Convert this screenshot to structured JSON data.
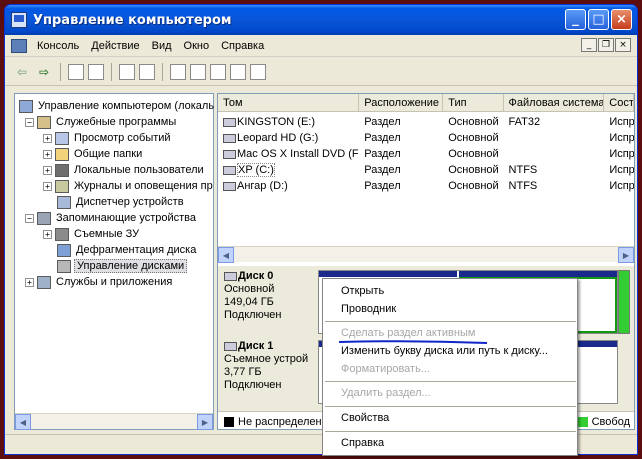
{
  "window": {
    "title": "Управление компьютером",
    "buttons": {
      "minimize": "_",
      "maximize": "□",
      "close": "×"
    }
  },
  "menubar": {
    "items": [
      "Консоль",
      "Действие",
      "Вид",
      "Окно",
      "Справка"
    ],
    "mdi": {
      "minimize": "_",
      "restore": "❐",
      "close": "×"
    }
  },
  "toolbar": {
    "icons": [
      "back-icon",
      "forward-icon",
      "up-icon",
      "show-hide-tree-icon",
      "help-icon",
      "properties-icon",
      "refresh-icon",
      "disk-settings-icon",
      "open-icon",
      "search-icon",
      "disk-props-icon"
    ],
    "back": "⇦",
    "forward": "⇨"
  },
  "tree": {
    "items": [
      {
        "label": "Управление компьютером (локаль",
        "level": 0,
        "expander": ""
      },
      {
        "label": "Служебные программы",
        "level": 1,
        "expander": "−"
      },
      {
        "label": "Просмотр событий",
        "level": 2,
        "expander": "+"
      },
      {
        "label": "Общие папки",
        "level": 2,
        "expander": "+"
      },
      {
        "label": "Локальные пользователи",
        "level": 2,
        "expander": "+"
      },
      {
        "label": "Журналы и оповещения пр",
        "level": 2,
        "expander": "+"
      },
      {
        "label": "Диспетчер устройств",
        "level": 2,
        "expander": ""
      },
      {
        "label": "Запоминающие устройства",
        "level": 1,
        "expander": "−"
      },
      {
        "label": "Съемные ЗУ",
        "level": 2,
        "expander": "+"
      },
      {
        "label": "Дефрагментация диска",
        "level": 2,
        "expander": ""
      },
      {
        "label": "Управление дисками",
        "level": 2,
        "expander": "",
        "selected": true
      },
      {
        "label": "Службы и приложения",
        "level": 1,
        "expander": "+"
      }
    ]
  },
  "volumes": {
    "columns": [
      "Том",
      "Расположение",
      "Тип",
      "Файловая система",
      "Сост"
    ],
    "rows": [
      [
        "KINGSTON (E:)",
        "Раздел",
        "Основной",
        "FAT32",
        "Испр"
      ],
      [
        "Leopard HD (G:)",
        "Раздел",
        "Основной",
        "",
        "Испр"
      ],
      [
        "Mac OS X Install DVD (F:)",
        "Раздел",
        "Основной",
        "",
        "Испр"
      ],
      [
        "XP (C:)",
        "Раздел",
        "Основной",
        "NTFS",
        "Испр"
      ],
      [
        "Ангар (D:)",
        "Раздел",
        "Основной",
        "NTFS",
        "Испр"
      ]
    ]
  },
  "disks": [
    {
      "name": "Диск 0",
      "type": "Основной",
      "size": "149,04 ГБ",
      "status": "Подключен"
    },
    {
      "name": "Диск 1",
      "type": "Съемное устрой",
      "size": "3,77 ГБ",
      "status": "Подключен"
    }
  ],
  "legend": {
    "unallocated": "Не распределен",
    "free": "Свобод",
    "colors": {
      "unallocated": "#000000",
      "free": "#33cc33",
      "primary": "#1a2a8c",
      "logical": "#119911"
    }
  },
  "context_menu": {
    "items": [
      {
        "label": "Открыть",
        "enabled": true
      },
      {
        "label": "Проводник",
        "enabled": true
      },
      {
        "label": "Сделать раздел активным",
        "enabled": false
      },
      {
        "label": "Изменить букву диска или путь к диску...",
        "enabled": true
      },
      {
        "label": "Форматировать...",
        "enabled": false
      },
      {
        "label": "Удалить раздел...",
        "enabled": false
      },
      {
        "label": "Свойства",
        "enabled": true
      },
      {
        "label": "Справка",
        "enabled": true
      }
    ]
  }
}
